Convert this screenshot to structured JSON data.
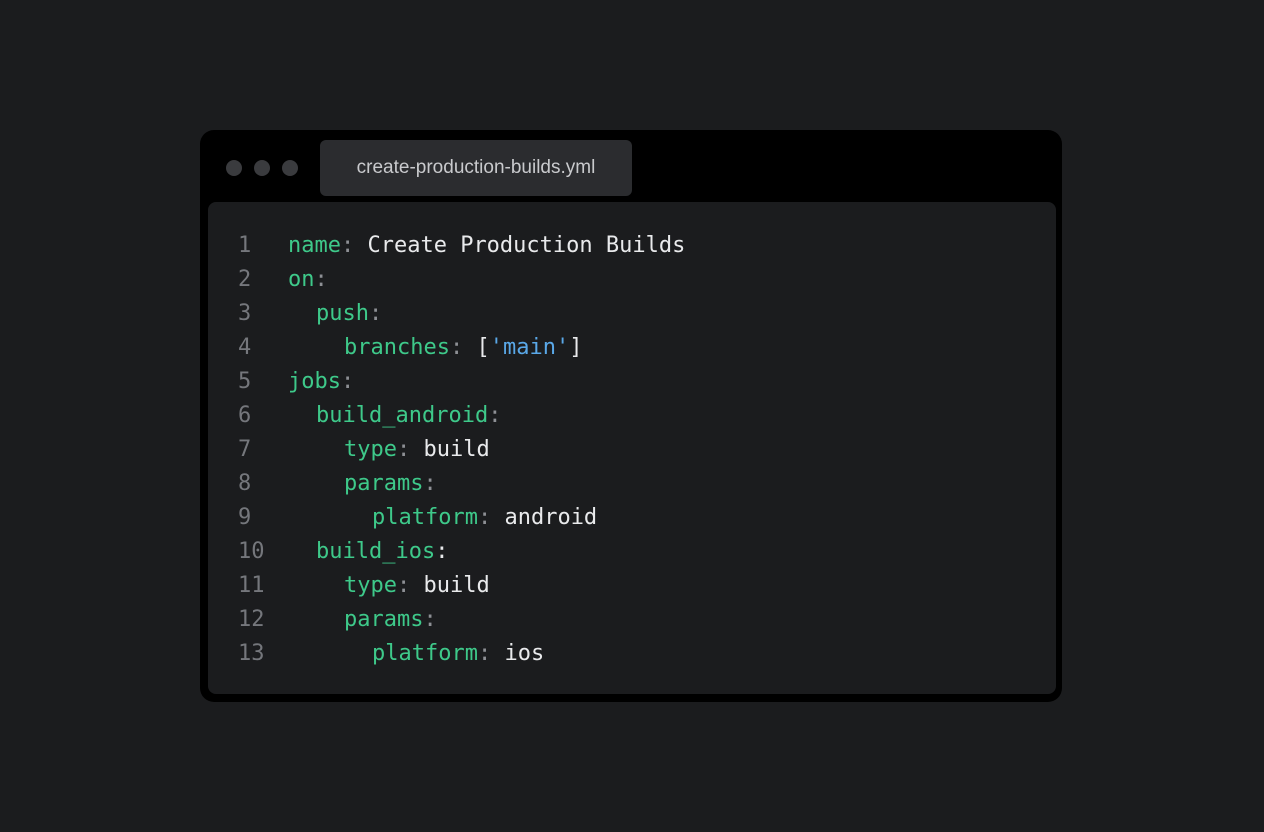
{
  "window": {
    "tab_title": "create-production-builds.yml",
    "traffic_light_color": "#3a3b3e"
  },
  "colors": {
    "key": "#3ec98a",
    "punctuation": "#8e9095",
    "value": "#e9eaec",
    "string": "#5aa8e8",
    "line_number": "#75777c"
  },
  "lines": [
    {
      "n": "1",
      "indent": 0,
      "key": "name",
      "colon": ":",
      "value": " Create Production Builds"
    },
    {
      "n": "2",
      "indent": 0,
      "key": "on",
      "colon": ":"
    },
    {
      "n": "3",
      "indent": 1,
      "key": "push",
      "colon": ":"
    },
    {
      "n": "4",
      "indent": 2,
      "key": "branches",
      "colon": ":",
      "open": " [",
      "string": "'main'",
      "close": "]"
    },
    {
      "n": "5",
      "indent": 0,
      "key": "jobs",
      "colon": ":"
    },
    {
      "n": "6",
      "indent": 1,
      "key": "build_android",
      "colon": ":"
    },
    {
      "n": "7",
      "indent": 2,
      "key": "type",
      "colon": ":",
      "value": " build"
    },
    {
      "n": "8",
      "indent": 2,
      "key": "params",
      "colon": ":"
    },
    {
      "n": "9",
      "indent": 3,
      "key": "platform",
      "colon": ":",
      "value": " android"
    },
    {
      "n": "10",
      "indent": 1,
      "key": "build_ios",
      "colon": ":",
      "colon_bright": true
    },
    {
      "n": "11",
      "indent": 2,
      "key": "type",
      "colon": ":",
      "value": " build"
    },
    {
      "n": "12",
      "indent": 2,
      "key": "params",
      "colon": ":"
    },
    {
      "n": "13",
      "indent": 3,
      "key": "platform",
      "colon": ":",
      "value": " ios"
    }
  ]
}
